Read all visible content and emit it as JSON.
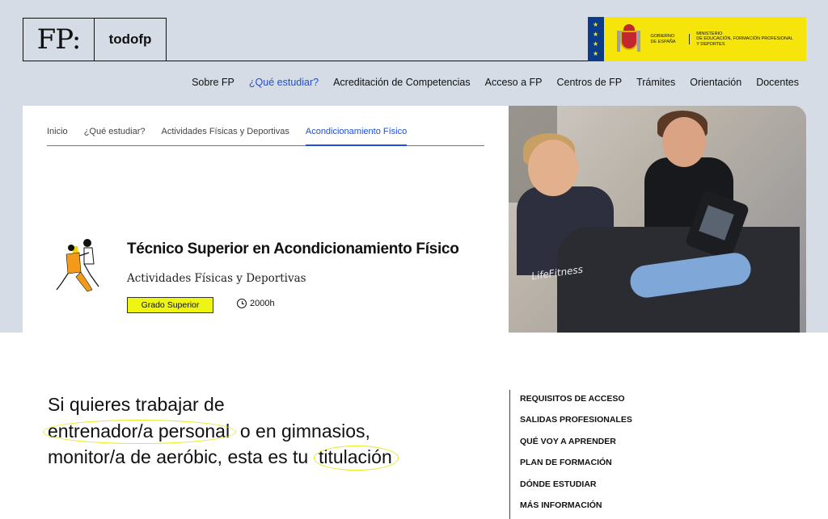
{
  "brand": {
    "logo_mark": "FP:",
    "site_name": "todofp"
  },
  "government": {
    "left_block": "GOBIERNO\nDE ESPAÑA",
    "right_block": "MINISTERIO\nDE EDUCACIÓN, FORMACIÓN PROFESIONAL\nY DEPORTES"
  },
  "main_nav": [
    {
      "label": "Sobre FP"
    },
    {
      "label": "¿Qué estudiar?"
    },
    {
      "label": "Acreditación de Competencias"
    },
    {
      "label": "Acceso a FP"
    },
    {
      "label": "Centros de FP"
    },
    {
      "label": "Trámites"
    },
    {
      "label": "Orientación"
    },
    {
      "label": "Docentes"
    }
  ],
  "breadcrumbs": [
    {
      "label": "Inicio"
    },
    {
      "label": "¿Qué estudiar?"
    },
    {
      "label": "Actividades Físicas y Deportivas"
    },
    {
      "label": "Acondicionamiento Físico"
    }
  ],
  "course": {
    "title": "Técnico Superior en Acondicionamiento Físico",
    "family": "Actividades Físicas y Deportivas",
    "level_badge": "Grado Superior",
    "hours": "2000h"
  },
  "photo": {
    "brand_text": "LifeFitness"
  },
  "pitch": {
    "part1": "Si quieres trabajar de",
    "highlight1": "entrenador/a personal",
    "part2": "o en gimnasios,",
    "part3": "monitor/a de aeróbic, esta es tu",
    "highlight2": "titulación"
  },
  "side_nav": [
    {
      "label": "REQUISITOS DE ACCESO"
    },
    {
      "label": "SALIDAS PROFESIONALES"
    },
    {
      "label": "QUÉ VOY A APRENDER"
    },
    {
      "label": "PLAN DE FORMACIÓN"
    },
    {
      "label": "DÓNDE ESTUDIAR"
    },
    {
      "label": "MÁS INFORMACIÓN"
    }
  ],
  "colors": {
    "header_bg": "#d5dce5",
    "accent_blue": "#1f4fd6",
    "badge_yellow": "#eef512",
    "gov_yellow": "#f5e50a"
  }
}
